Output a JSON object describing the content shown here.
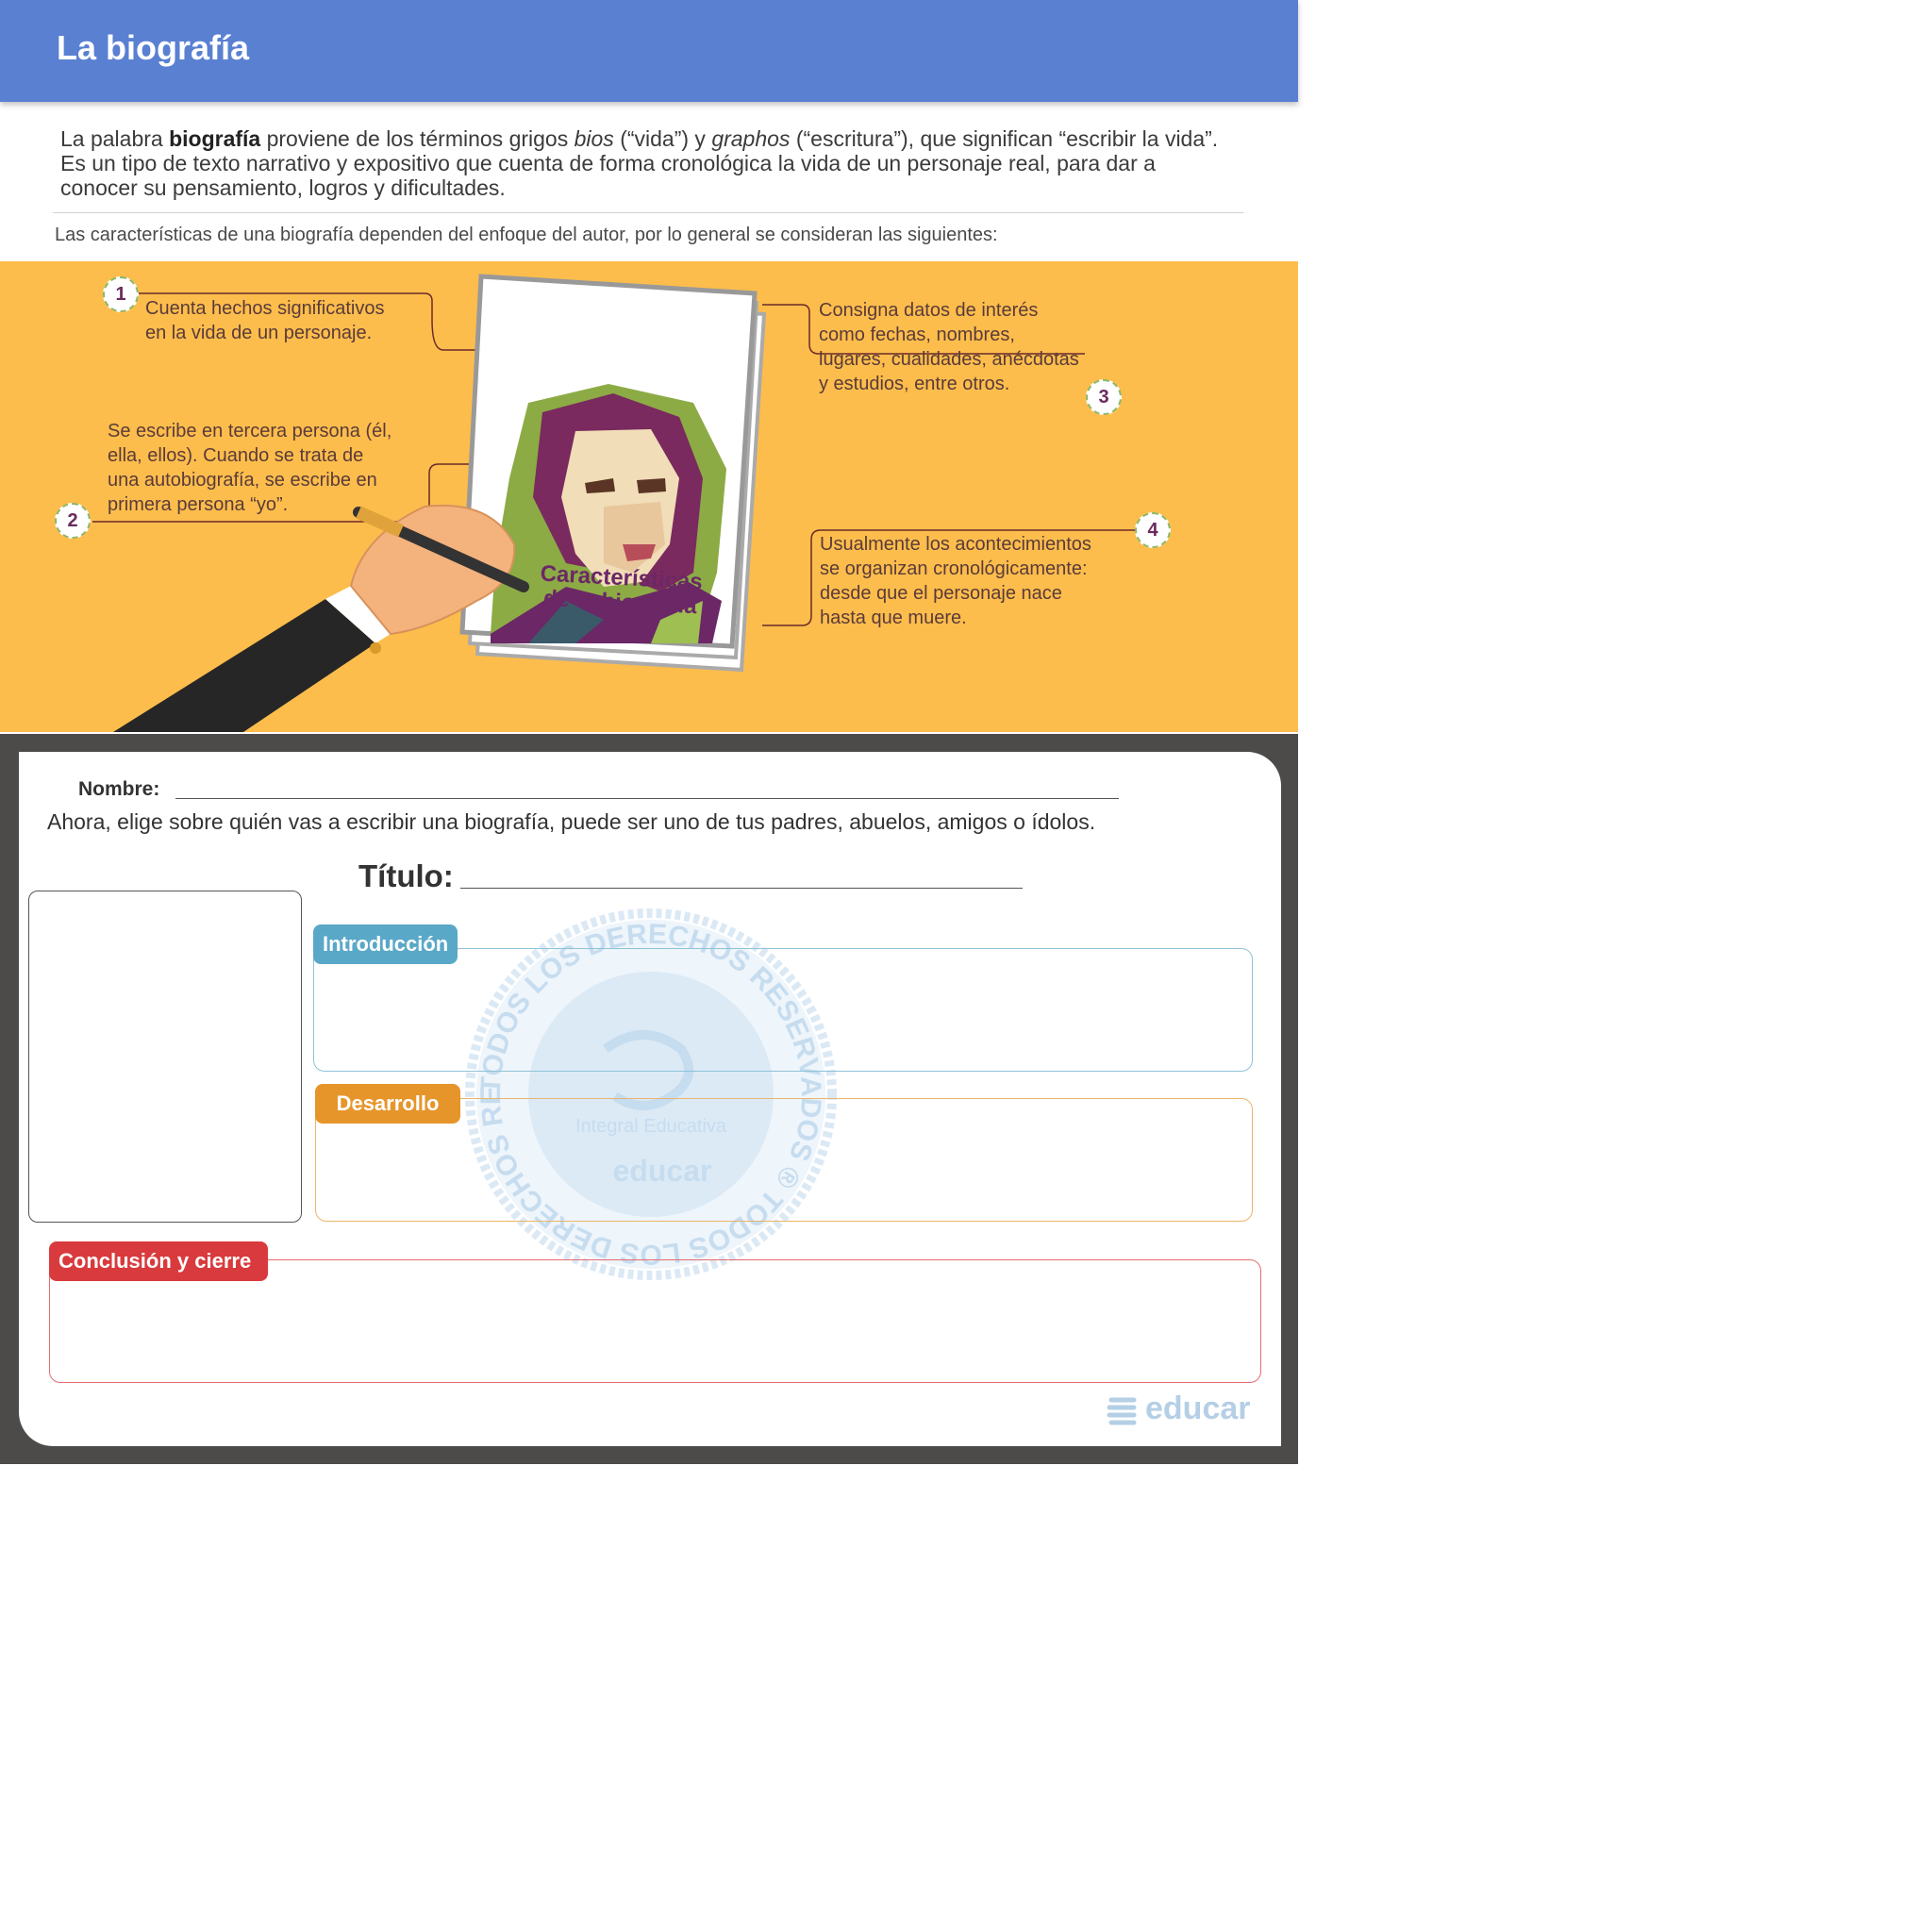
{
  "header": {
    "title": "La biografía"
  },
  "intro": {
    "t1": "La palabra ",
    "bold": "biografía",
    "t2": " proviene de los términos grigos ",
    "i1": "bios",
    "t3": " (“vida”) y ",
    "i2": "graphos",
    "t4": " (“escritura”), que significan “escribir la vida”. Es un tipo de texto narrativo y expositivo que cuenta de forma cronológica la vida de un personaje real, para dar a conocer su pensamiento, logros y dificultades."
  },
  "lead": "Las características de una biografía dependen del enfoque del autor, por lo general se consideran las siguientes:",
  "book": {
    "title_line1": "Características",
    "title_line2": "de la biografía"
  },
  "features": [
    {
      "num": "1",
      "line1": "Cuenta hechos significativos",
      "line2": "en la vida de un personaje."
    },
    {
      "num": "2",
      "line1": "Se escribe en tercera persona (él,",
      "line2": "ella, ellos). Cuando se trata de",
      "line3": "una autobiografía, se escribe en",
      "line4": "primera persona “yo”."
    },
    {
      "num": "3",
      "line1": "Consigna datos de interés",
      "line2": "como fechas, nombres,",
      "line3": "lugares, cualidades, anécdotas",
      "line4": "y estudios, entre otros."
    },
    {
      "num": "4",
      "line1": "Usualmente los acontecimientos",
      "line2": "se organizan cronológicamente:",
      "line3": "desde que el personaje nace",
      "line4": "hasta que muere."
    }
  ],
  "worksheet": {
    "name_label": "Nombre:",
    "instruction": "Ahora, elige sobre quién vas a escribir una biografía, puede ser uno de tus padres, abuelos, amigos o ídolos.",
    "title_label": "Título:",
    "sections": [
      {
        "label": "Introducción",
        "color": "#5aa8c8"
      },
      {
        "label": "Desarrollo",
        "color": "#e6952b"
      },
      {
        "label": "Conclusión y cierre",
        "color": "#d93a3d"
      }
    ]
  },
  "watermark": {
    "ring_text": "TODOS LOS DERECHOS RESERVADOS ® TODOS LOS DERECHOS RESERVADOS ®",
    "sub": "Integral Educativa",
    "brand": "educar"
  },
  "footer": {
    "brand": "educar"
  },
  "colors": {
    "header": "#5a80d2",
    "band": "#fdbd4c",
    "frame": "#4c4b4a",
    "accent": "#6b2766"
  }
}
